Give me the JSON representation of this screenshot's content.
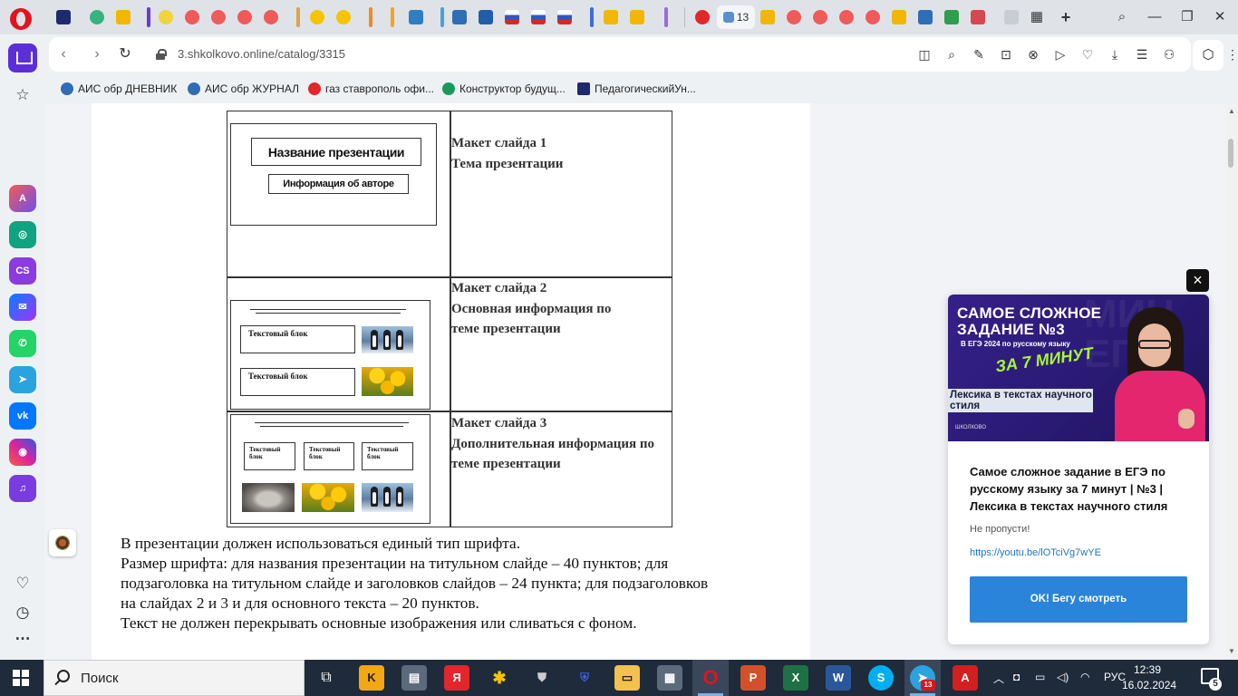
{
  "browser": {
    "url": "3.shkolkovo.online/catalog/3315",
    "active_tab_count": "13",
    "bookmarks": [
      {
        "label": "АИС обр ДНЕВНИК",
        "color": "#2f6db5"
      },
      {
        "label": "АИС обр ЖУРНАЛ",
        "color": "#2f6db5"
      },
      {
        "label": "газ ставрополь офи...",
        "color": "#e3262b"
      },
      {
        "label": "Конструктор будущ...",
        "color": "#1a9a5a"
      },
      {
        "label": "ПедагогическийУн...",
        "color": "#1d2a6b"
      }
    ],
    "toolbar_icons": [
      "split-screen-icon",
      "search-icon",
      "edit-icon",
      "camera-icon",
      "shield-icon",
      "play-icon",
      "heart-icon",
      "download-icon",
      "easy-setup-icon",
      "profile-icon",
      "extensions-icon",
      "menu-icon"
    ],
    "sidebar_labels": [
      "Aria",
      "ChatGPT",
      "CS",
      "Messenger",
      "WhatsApp",
      "Telegram",
      "VK",
      "Instagram",
      "Music"
    ]
  },
  "table": {
    "rows": [
      {
        "desc": [
          "Макет слайда 1",
          "Тема презентации"
        ]
      },
      {
        "desc": [
          "Макет слайда 2",
          "Основная информация по",
          "теме презентации"
        ]
      },
      {
        "desc": [
          "Макет слайда 3",
          "Дополнительная информация по",
          "теме презентации"
        ]
      }
    ],
    "slide1": {
      "title_box": "Название презентации",
      "author_box": "Информация об авторе"
    },
    "slide2": {
      "text_block_1": "Текстовый блок",
      "text_block_2": "Текстовый блок"
    },
    "slide3": {
      "text_block_1": "Текстовый блок",
      "text_block_2": "Текстовый блок",
      "text_block_3": "Текстовый блок"
    }
  },
  "body_text": [
    "В презентации должен использоваться единый тип шрифта.",
    "Размер шрифта: для названия презентации на титульном слайде – 40 пунктов; для",
    "подзаголовка на титульном слайде и заголовков слайдов – 24 пункта; для подзаголовков",
    "на слайдах 2 и 3 и для основного текста – 20 пунктов.",
    "Текст не должен перекрывать основные изображения или сливаться с фоном."
  ],
  "popup": {
    "thumb_title": "САМОЕ СЛОЖНОЕ ЗАДАНИЕ №3",
    "thumb_sub": "В ЕГЭ 2024 по русскому языку",
    "thumb_accent": "ЗА 7 МИНУТ",
    "thumb_banner": "Лексика в текстах научного стиля",
    "thumb_logo": "ШКОЛКОВО",
    "title": "Самое сложное задание в ЕГЭ по русскому языку за 7 минут | №3 | Лексика в текстах научного стиля",
    "subtitle": "Не пропусти!",
    "link": "https://youtu.be/lOTciVg7wYE",
    "button": "OK! Бегу смотреть",
    "close": "×"
  },
  "taskbar": {
    "search_placeholder": "Поиск",
    "language": "РУС",
    "time": "12:39",
    "date": "16.02.2024",
    "notifications": "5",
    "telegram_badge": "13"
  },
  "colors": {
    "accent": "#2a84d9",
    "opera_red": "#e0141e",
    "sidebar_home": "#5a2fd8",
    "taskbar": "#1f2a3a"
  }
}
